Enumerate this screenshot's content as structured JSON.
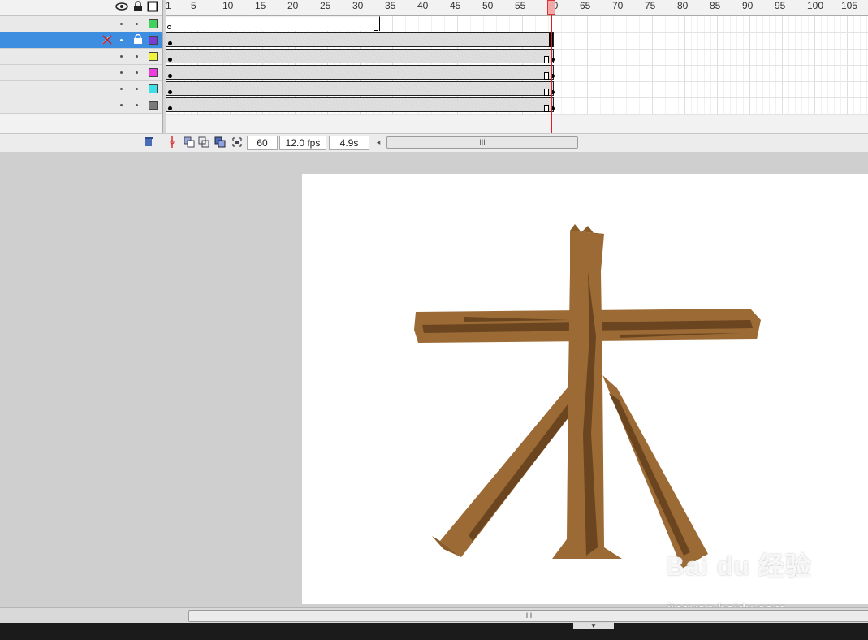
{
  "timeline": {
    "ruler_numbers": [
      "1",
      "5",
      "10",
      "15",
      "20",
      "25",
      "30",
      "35",
      "40",
      "45",
      "50",
      "55",
      "60",
      "65",
      "70",
      "75",
      "80",
      "85",
      "90",
      "95",
      "100",
      "105"
    ],
    "layers": [
      {
        "color": "#3fd35e",
        "selected": false,
        "span": "partial"
      },
      {
        "color": "#7a3cd0",
        "selected": true,
        "span": "full"
      },
      {
        "color": "#f2f23a",
        "selected": false,
        "span": "full"
      },
      {
        "color": "#ee3ce0",
        "selected": false,
        "span": "full"
      },
      {
        "color": "#3ce0e6",
        "selected": false,
        "span": "full"
      },
      {
        "color": "#7a7a7a",
        "selected": false,
        "span": "full"
      }
    ],
    "header_icons": [
      "eye-icon",
      "lock-icon",
      "outline-icon"
    ],
    "current_frame": "60",
    "frame_rate": "12.0 fps",
    "elapsed_time": "4.9s",
    "scroll_grip": "III"
  },
  "stage": {
    "wood_color": "#9b6a35",
    "wood_shadow": "#6b4520",
    "watermark": "Bai du 经验",
    "watermark_url": "jingyan.baidu.com"
  },
  "bottom": {
    "scroll_grip": "III",
    "tab_glyph": "▼"
  }
}
